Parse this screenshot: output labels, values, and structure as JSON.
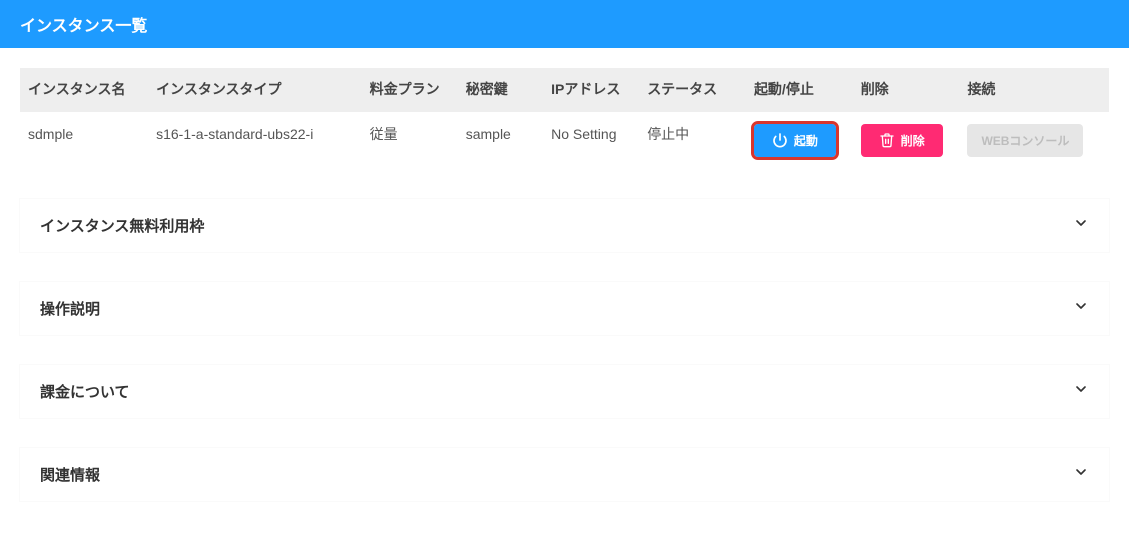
{
  "header": {
    "title": "インスタンス一覧"
  },
  "table": {
    "columns": {
      "name": "インスタンス名",
      "type": "インスタンスタイプ",
      "plan": "料金プラン",
      "key": "秘密鍵",
      "ip": "IPアドレス",
      "status": "ステータス",
      "startstop": "起動/停止",
      "delete": "削除",
      "connect": "接続"
    },
    "rows": [
      {
        "name": "sdmple",
        "type": "s16-1-a-standard-ubs22-i",
        "plan": "従量",
        "key": "sample",
        "ip": "No Setting",
        "status": "停止中",
        "start_label": "起動",
        "delete_label": "削除",
        "connect_label": "WEBコンソール"
      }
    ]
  },
  "accordion": {
    "items": [
      {
        "label": "インスタンス無料利用枠"
      },
      {
        "label": "操作説明"
      },
      {
        "label": "課金について"
      },
      {
        "label": "関連情報"
      }
    ]
  },
  "colors": {
    "accent_blue": "#1e9bff",
    "accent_pink": "#ff2a73",
    "highlight_red": "#d9362d",
    "disabled_bg": "#e6e6e6"
  }
}
